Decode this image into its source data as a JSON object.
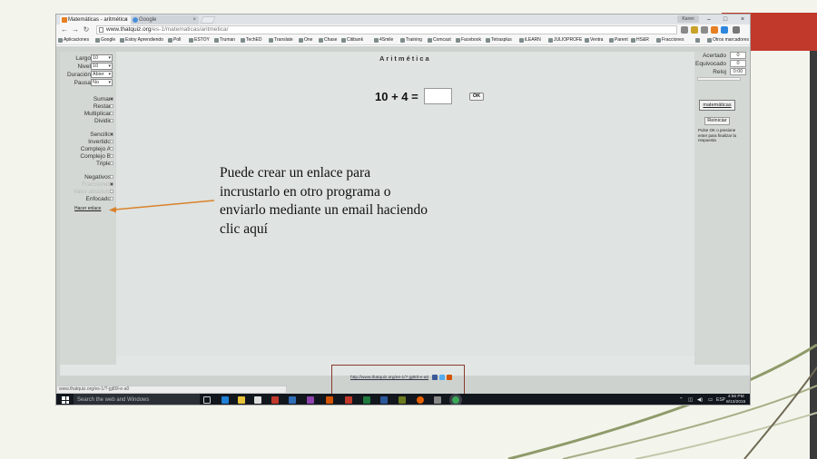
{
  "browser": {
    "tabs": [
      {
        "label": "Matemáticas - aritmética",
        "active": true
      },
      {
        "label": "Google",
        "active": false
      }
    ],
    "user_chip": "Karen",
    "url_host": "www.thatquiz.org",
    "url_path": "/es-1/matematicas/aritmetica/",
    "bookmarks": [
      "Aplicaciones",
      "Google",
      "Estoy Aprendiendo",
      "Poll",
      "ESTOY",
      "Truman",
      "TechED",
      "Translate",
      "One",
      "Chase",
      "Citibank",
      "4Smile",
      "Training",
      "Comcast",
      "Facebook",
      "Tetrasplus",
      "iLEARN",
      "JULIOPROFE",
      "Ventra",
      "Parent",
      "HS&R",
      "Fracciones"
    ],
    "bookmarks_more": "»",
    "bookmarks_other": "Otros marcadores",
    "status_url": "www.thatquiz.org/es-1/?-jg80l-e-a0"
  },
  "left_panel": {
    "controls": [
      {
        "label": "Largo",
        "value": "10"
      },
      {
        "label": "Nivel",
        "value": "10"
      },
      {
        "label": "Duración",
        "value": "Abier"
      },
      {
        "label": "Pausa",
        "value": "No"
      }
    ],
    "operations": [
      "Sumar",
      "Restar",
      "Multiplicar",
      "Dividir"
    ],
    "formats": [
      "Sencillo",
      "Invertido",
      "Complejo A",
      "Complejo B",
      "Triple"
    ],
    "options": [
      {
        "label": "Negativos",
        "disabled": false
      },
      {
        "label": "Fracciones",
        "disabled": true
      },
      {
        "label": "Valor absoluto",
        "disabled": true
      },
      {
        "label": "Enfocado",
        "disabled": false
      }
    ],
    "link": "Hacer enlace"
  },
  "main": {
    "title": "Aritmética",
    "question": "10 + 4  =",
    "answer_value": "",
    "ok_label": "OK"
  },
  "right_panel": {
    "stats": [
      {
        "label": "Acertado",
        "value": "0"
      },
      {
        "label": "Equivocado",
        "value": "0"
      },
      {
        "label": "Reloj",
        "value": "0:00"
      }
    ],
    "matematicas_label": "matemáticas",
    "reiniciar_label": "Reiniciar",
    "hint": "Pulse OK o presione enter para finalizar la respuesta"
  },
  "share": {
    "url": "http://www.thatquiz.org/es-1/?-jg80l-e-a0"
  },
  "taskbar": {
    "search_placeholder": "Search the web and Windows",
    "language": "ESP",
    "time": "4:56 PM",
    "date": "8/13/2015"
  },
  "annotation": {
    "text": "Puede crear un enlace para incrustarlo en otro programa o enviarlo mediante un email haciendo clic aquí"
  },
  "colors": {
    "accent_red": "#c0392b",
    "highlight_box": "#8a3a2a",
    "arrow": "#d9822b"
  }
}
